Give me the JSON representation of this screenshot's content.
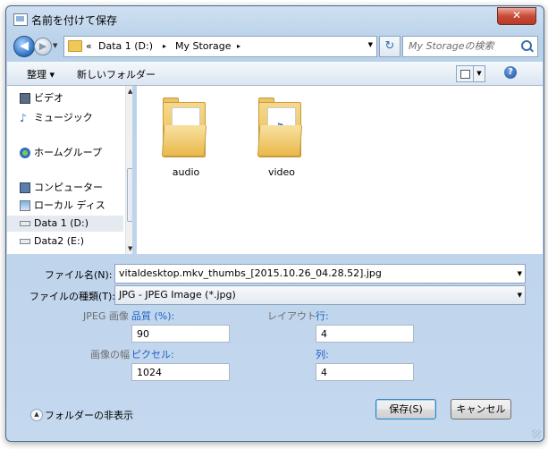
{
  "window": {
    "title": "名前を付けて保存",
    "close_label": "✕"
  },
  "nav": {
    "back_glyph": "◀",
    "forward_glyph": "▶",
    "breadcrumb": {
      "prefix": "«",
      "items": [
        "Data 1 (D:)",
        "My Storage"
      ],
      "separator": "▸"
    },
    "refresh_glyph": "↻",
    "search_placeholder": "My Storageの検索"
  },
  "toolbar": {
    "organize": "整理 ▾",
    "new_folder": "新しいフォルダー",
    "help": "?"
  },
  "sidebar": {
    "items": [
      {
        "label": "ビデオ",
        "icon": "video-icon"
      },
      {
        "label": "ミュージック",
        "icon": "music-icon"
      },
      {
        "label": "ホームグループ",
        "icon": "homegroup-icon"
      },
      {
        "label": "コンピューター",
        "icon": "computer-icon"
      },
      {
        "label": "ローカル ディス",
        "icon": "disk-icon"
      },
      {
        "label": "Data 1 (D:)",
        "icon": "drive-icon",
        "selected": true
      },
      {
        "label": "Data2 (E:)",
        "icon": "drive-icon"
      }
    ]
  },
  "files": [
    {
      "name": "audio",
      "icon": "folder-icon"
    },
    {
      "name": "video",
      "icon": "folder-icon"
    }
  ],
  "form": {
    "filename_label": "ファイル名(N):",
    "filename_value": "vitaldesktop.mkv_thumbs_[2015.10.26_04.28.52].jpg",
    "filetype_label": "ファイルの種類(T):",
    "filetype_value": "JPG - JPEG Image (*.jpg)",
    "jpeg_label": "JPEG 画像",
    "quality_label": "品質 (%):",
    "quality_value": "90",
    "layout_label": "レイアウト",
    "rows_label": "行:",
    "rows_value": "4",
    "width_label": "画像の幅",
    "pixels_label": "ピクセル:",
    "width_value": "1024",
    "cols_label": "列:",
    "cols_value": "4"
  },
  "footer": {
    "hide_folders": "フォルダーの非表示",
    "save": "保存(S)",
    "cancel": "キャンセル"
  },
  "colors": {
    "link": "#1b60c4",
    "title_bar": "#b9d1ea",
    "close": "#c94a36"
  }
}
